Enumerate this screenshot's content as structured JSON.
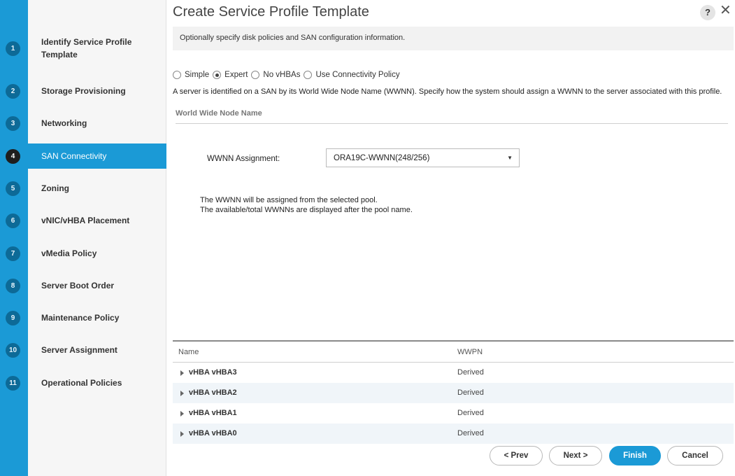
{
  "wizard": {
    "steps": [
      {
        "num": "1",
        "label": "Identify Service Profile Template"
      },
      {
        "num": "2",
        "label": "Storage Provisioning"
      },
      {
        "num": "3",
        "label": "Networking"
      },
      {
        "num": "4",
        "label": "SAN Connectivity"
      },
      {
        "num": "5",
        "label": "Zoning"
      },
      {
        "num": "6",
        "label": "vNIC/vHBA Placement"
      },
      {
        "num": "7",
        "label": "vMedia Policy"
      },
      {
        "num": "8",
        "label": "Server Boot Order"
      },
      {
        "num": "9",
        "label": "Maintenance Policy"
      },
      {
        "num": "10",
        "label": "Server Assignment"
      },
      {
        "num": "11",
        "label": "Operational Policies"
      }
    ],
    "active_step": "4"
  },
  "header": {
    "title": "Create Service Profile Template",
    "help_label": "?",
    "close_label": "✕"
  },
  "banner": "Optionally specify disk policies and SAN configuration information.",
  "mode": {
    "options": [
      "Simple",
      "Expert",
      "No vHBAs",
      "Use Connectivity Policy"
    ],
    "selected": "Expert"
  },
  "description": "A server is identified on a SAN by its World Wide Node Name (WWNN). Specify how the system should assign a WWNN to the server associated with this profile.",
  "wwnn": {
    "section_title": "World Wide Node Name",
    "label": "WWNN Assignment:",
    "selected": "ORA19C-WWNN(248/256)",
    "note_line1": "The WWNN will be assigned from the selected pool.",
    "note_line2": "The available/total WWNNs are displayed after the pool name."
  },
  "table": {
    "columns": [
      "Name",
      "WWPN"
    ],
    "rows": [
      {
        "name": "vHBA vHBA3",
        "wwpn": "Derived"
      },
      {
        "name": "vHBA vHBA2",
        "wwpn": "Derived"
      },
      {
        "name": "vHBA vHBA1",
        "wwpn": "Derived"
      },
      {
        "name": "vHBA vHBA0",
        "wwpn": "Derived"
      }
    ]
  },
  "footer": {
    "prev": "< Prev",
    "next": "Next >",
    "finish": "Finish",
    "cancel": "Cancel"
  },
  "colors": {
    "accent": "#1b9ad6",
    "step_badge": "#0d6a97"
  }
}
